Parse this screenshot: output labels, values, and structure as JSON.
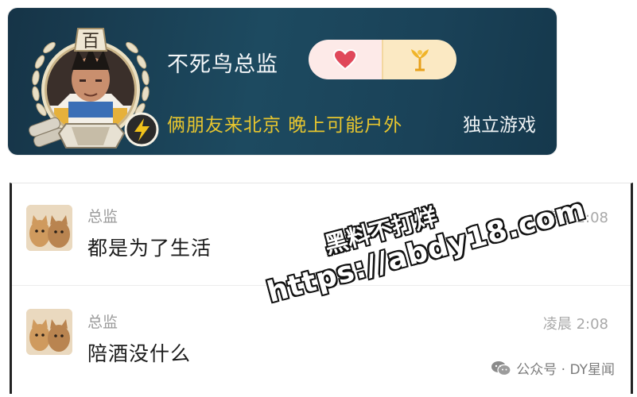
{
  "profile": {
    "level_glyph": "百",
    "name": "不死鸟总监",
    "status": "俩朋友来北京 晚上可能户外",
    "tag": "独立游戏",
    "icons": [
      "laurel-wreath-badge-icon",
      "lightning-icon",
      "cannon-icon",
      "heart-icon",
      "crown-plant-icon"
    ],
    "colors": {
      "card_bg": "#1d4a60",
      "status_text": "#e8c62e",
      "lightning": "#f2c21b",
      "heart": "#e0485a"
    }
  },
  "chat": {
    "messages": [
      {
        "sender": "总监",
        "time": "凌晨 2:08",
        "text": "都是为了生活"
      },
      {
        "sender": "总监",
        "time": "凌晨 2:08",
        "text": "陪酒没什么"
      }
    ],
    "source_label": "公众号 · DY星闻"
  },
  "watermark": {
    "line1": "黑料不打烊",
    "line2": "https://abdy18.com"
  }
}
